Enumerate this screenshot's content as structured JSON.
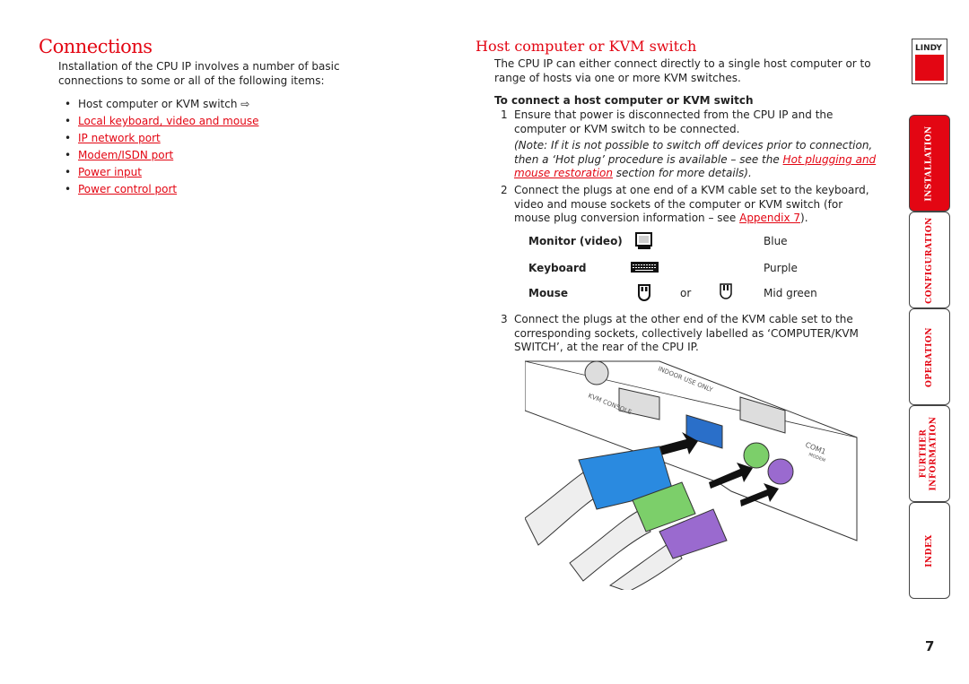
{
  "left": {
    "title": "Connections",
    "intro": "Installation of the CPU IP involves a number of basic connections to some or all of the following items:",
    "items": [
      {
        "label": "Host computer or KVM switch ⇨",
        "link": false
      },
      {
        "label": "Local keyboard, video and mouse",
        "link": true
      },
      {
        "label": "IP network port",
        "link": true
      },
      {
        "label": "Modem/ISDN port",
        "link": true
      },
      {
        "label": "Power input",
        "link": true
      },
      {
        "label": "Power control port",
        "link": true
      }
    ]
  },
  "right": {
    "title": "Host computer or KVM switch",
    "intro": "The CPU IP can either connect directly to a single host computer or to range of hosts via one or more KVM switches.",
    "subheading": "To connect a host computer or KVM switch",
    "step1": {
      "num": "1",
      "text": "Ensure that power is disconnected from the CPU IP and the computer or KVM switch to be connected.",
      "note_a": "(Note: If it is not possible to switch off devices prior to connection, then a ‘Hot plug’ procedure is available – see the ",
      "note_link": "Hot plugging and mouse restoration",
      "note_b": " section for more details)."
    },
    "step2": {
      "num": "2",
      "text": "Connect the plugs at one end of a KVM cable set to the keyboard, video and mouse sockets of the computer or KVM switch (for mouse plug conversion information – see ",
      "link": "Appendix 7",
      "end": ")."
    },
    "table": [
      {
        "label": "Monitor (video)",
        "icon": "monitor-icon",
        "color": "Blue"
      },
      {
        "label": "Keyboard",
        "icon": "keyboard-icon",
        "color": "Purple"
      },
      {
        "label": "Mouse",
        "icon": "mouse-icon",
        "or": "or",
        "color": "Mid green"
      }
    ],
    "step3": {
      "num": "3",
      "text": "Connect the plugs at the other end of the KVM cable set to the corresponding sockets, collectively labelled as ‘COMPUTER/KVM SWITCH’, at the rear of the CPU IP."
    },
    "illustration": {
      "labels": [
        "INDOOR USE ONLY",
        "KVM CONSOLE",
        "COM1",
        "MODEM"
      ]
    }
  },
  "logo": "LINDY",
  "tabs": [
    {
      "label": "INSTALLATION",
      "active": true
    },
    {
      "label": "CONFIGURATION"
    },
    {
      "label": "OPERATION"
    },
    {
      "label": "FURTHER INFORMATION"
    },
    {
      "label": "INDEX"
    }
  ],
  "page_number": "7",
  "colors": {
    "accent": "#e30613"
  }
}
